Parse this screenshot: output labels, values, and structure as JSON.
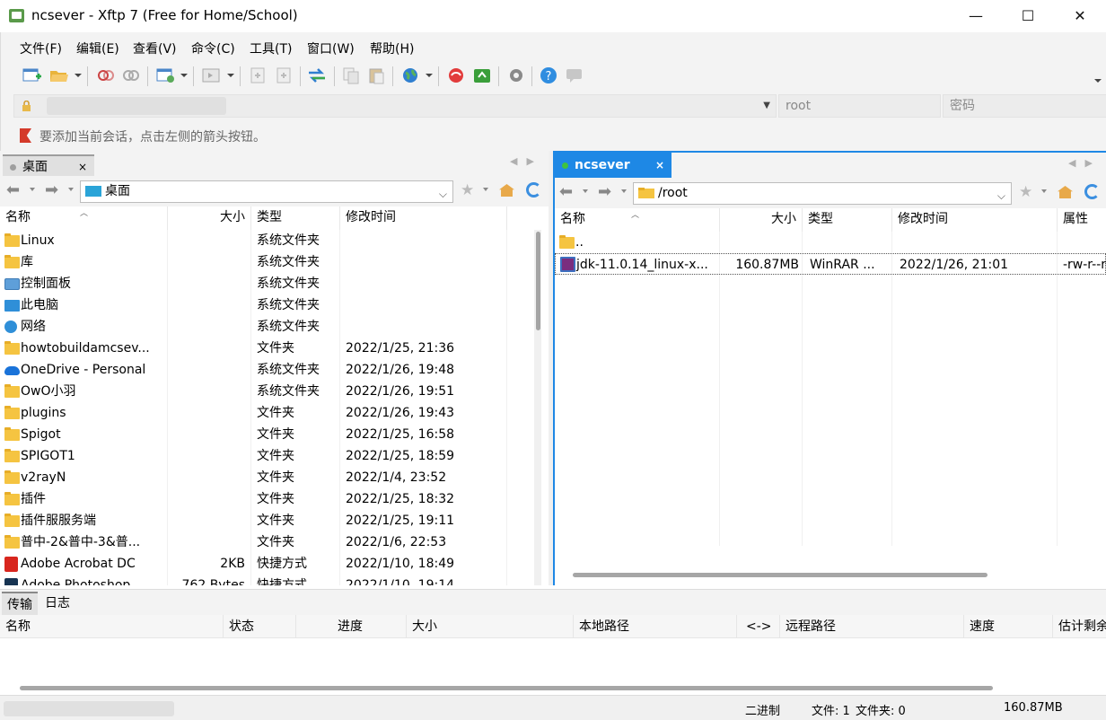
{
  "window": {
    "title": "ncsever - Xftp 7 (Free for Home/School)",
    "minimize": "—",
    "maximize": "☐",
    "close": "✕"
  },
  "menu": [
    "文件(F)",
    "编辑(E)",
    "查看(V)",
    "命令(C)",
    "工具(T)",
    "窗口(W)",
    "帮助(H)"
  ],
  "address": {
    "host_placeholder": "",
    "user": "root",
    "password_placeholder": "密码"
  },
  "hint": {
    "text": "要添加当前会话，点击左侧的箭头按钮。"
  },
  "local": {
    "tab_label": "桌面",
    "tab_close": "×",
    "path": "桌面",
    "columns": [
      "名称",
      "大小",
      "类型",
      "修改时间"
    ],
    "rows": [
      {
        "icon": "folder-icon",
        "name": "Linux",
        "size": "",
        "type": "系统文件夹",
        "modified": ""
      },
      {
        "icon": "folder-icon",
        "name": "库",
        "size": "",
        "type": "系统文件夹",
        "modified": ""
      },
      {
        "icon": "control-panel-icon",
        "name": "控制面板",
        "size": "",
        "type": "系统文件夹",
        "modified": ""
      },
      {
        "icon": "computer-icon",
        "name": "此电脑",
        "size": "",
        "type": "系统文件夹",
        "modified": ""
      },
      {
        "icon": "network-icon",
        "name": "网络",
        "size": "",
        "type": "系统文件夹",
        "modified": ""
      },
      {
        "icon": "folder-icon",
        "name": "howtobuildamcsev...",
        "size": "",
        "type": "文件夹",
        "modified": "2022/1/25, 21:36"
      },
      {
        "icon": "onedrive-icon",
        "name": "OneDrive - Personal",
        "size": "",
        "type": "系统文件夹",
        "modified": "2022/1/26, 19:48"
      },
      {
        "icon": "folder-icon",
        "name": "OwO小羽",
        "size": "",
        "type": "系统文件夹",
        "modified": "2022/1/26, 19:51"
      },
      {
        "icon": "folder-icon",
        "name": "plugins",
        "size": "",
        "type": "文件夹",
        "modified": "2022/1/26, 19:43"
      },
      {
        "icon": "folder-icon",
        "name": "Spigot",
        "size": "",
        "type": "文件夹",
        "modified": "2022/1/25, 16:58"
      },
      {
        "icon": "folder-icon",
        "name": "SPIGOT1",
        "size": "",
        "type": "文件夹",
        "modified": "2022/1/25, 18:59"
      },
      {
        "icon": "folder-icon",
        "name": "v2rayN",
        "size": "",
        "type": "文件夹",
        "modified": "2022/1/4, 23:52"
      },
      {
        "icon": "folder-icon",
        "name": "插件",
        "size": "",
        "type": "文件夹",
        "modified": "2022/1/25, 18:32"
      },
      {
        "icon": "folder-icon",
        "name": "插件服服务端",
        "size": "",
        "type": "文件夹",
        "modified": "2022/1/25, 19:11"
      },
      {
        "icon": "folder-icon",
        "name": "普中-2&普中-3&普...",
        "size": "",
        "type": "文件夹",
        "modified": "2022/1/6, 22:53"
      },
      {
        "icon": "acrobat-icon",
        "name": "Adobe Acrobat DC",
        "size": "2KB",
        "type": "快捷方式",
        "modified": "2022/1/10, 18:49"
      },
      {
        "icon": "photoshop-icon",
        "name": "Adobe Photoshop ...",
        "size": "762 Bytes",
        "type": "快捷方式",
        "modified": "2022/1/10, 19:14"
      }
    ]
  },
  "remote": {
    "tab_label": "ncsever",
    "tab_close": "×",
    "path": "/root",
    "columns": [
      "名称",
      "大小",
      "类型",
      "修改时间",
      "属性"
    ],
    "rows": [
      {
        "icon": "up-folder-icon",
        "name": "..",
        "size": "",
        "type": "",
        "modified": "",
        "attr": ""
      },
      {
        "icon": "rar-archive-icon",
        "name": "jdk-11.0.14_linux-x...",
        "size": "160.87MB",
        "type": "WinRAR ...",
        "modified": "2022/1/26, 21:01",
        "attr": "-rw-r--r--"
      }
    ]
  },
  "transfer": {
    "tabs": [
      "传输",
      "日志"
    ],
    "columns": [
      "名称",
      "状态",
      "进度",
      "大小",
      "本地路径",
      "<->",
      "远程路径",
      "速度",
      "估计剩余"
    ]
  },
  "status": {
    "mode": "二进制",
    "files": "文件: 1",
    "folders": "文件夹: 0",
    "size": "160.87MB"
  },
  "colors": {
    "accent": "#1e88e5",
    "remote_tab_bg": "#1e88e5",
    "folder": "#f5c441",
    "connected_dot": "#3fc33f"
  }
}
